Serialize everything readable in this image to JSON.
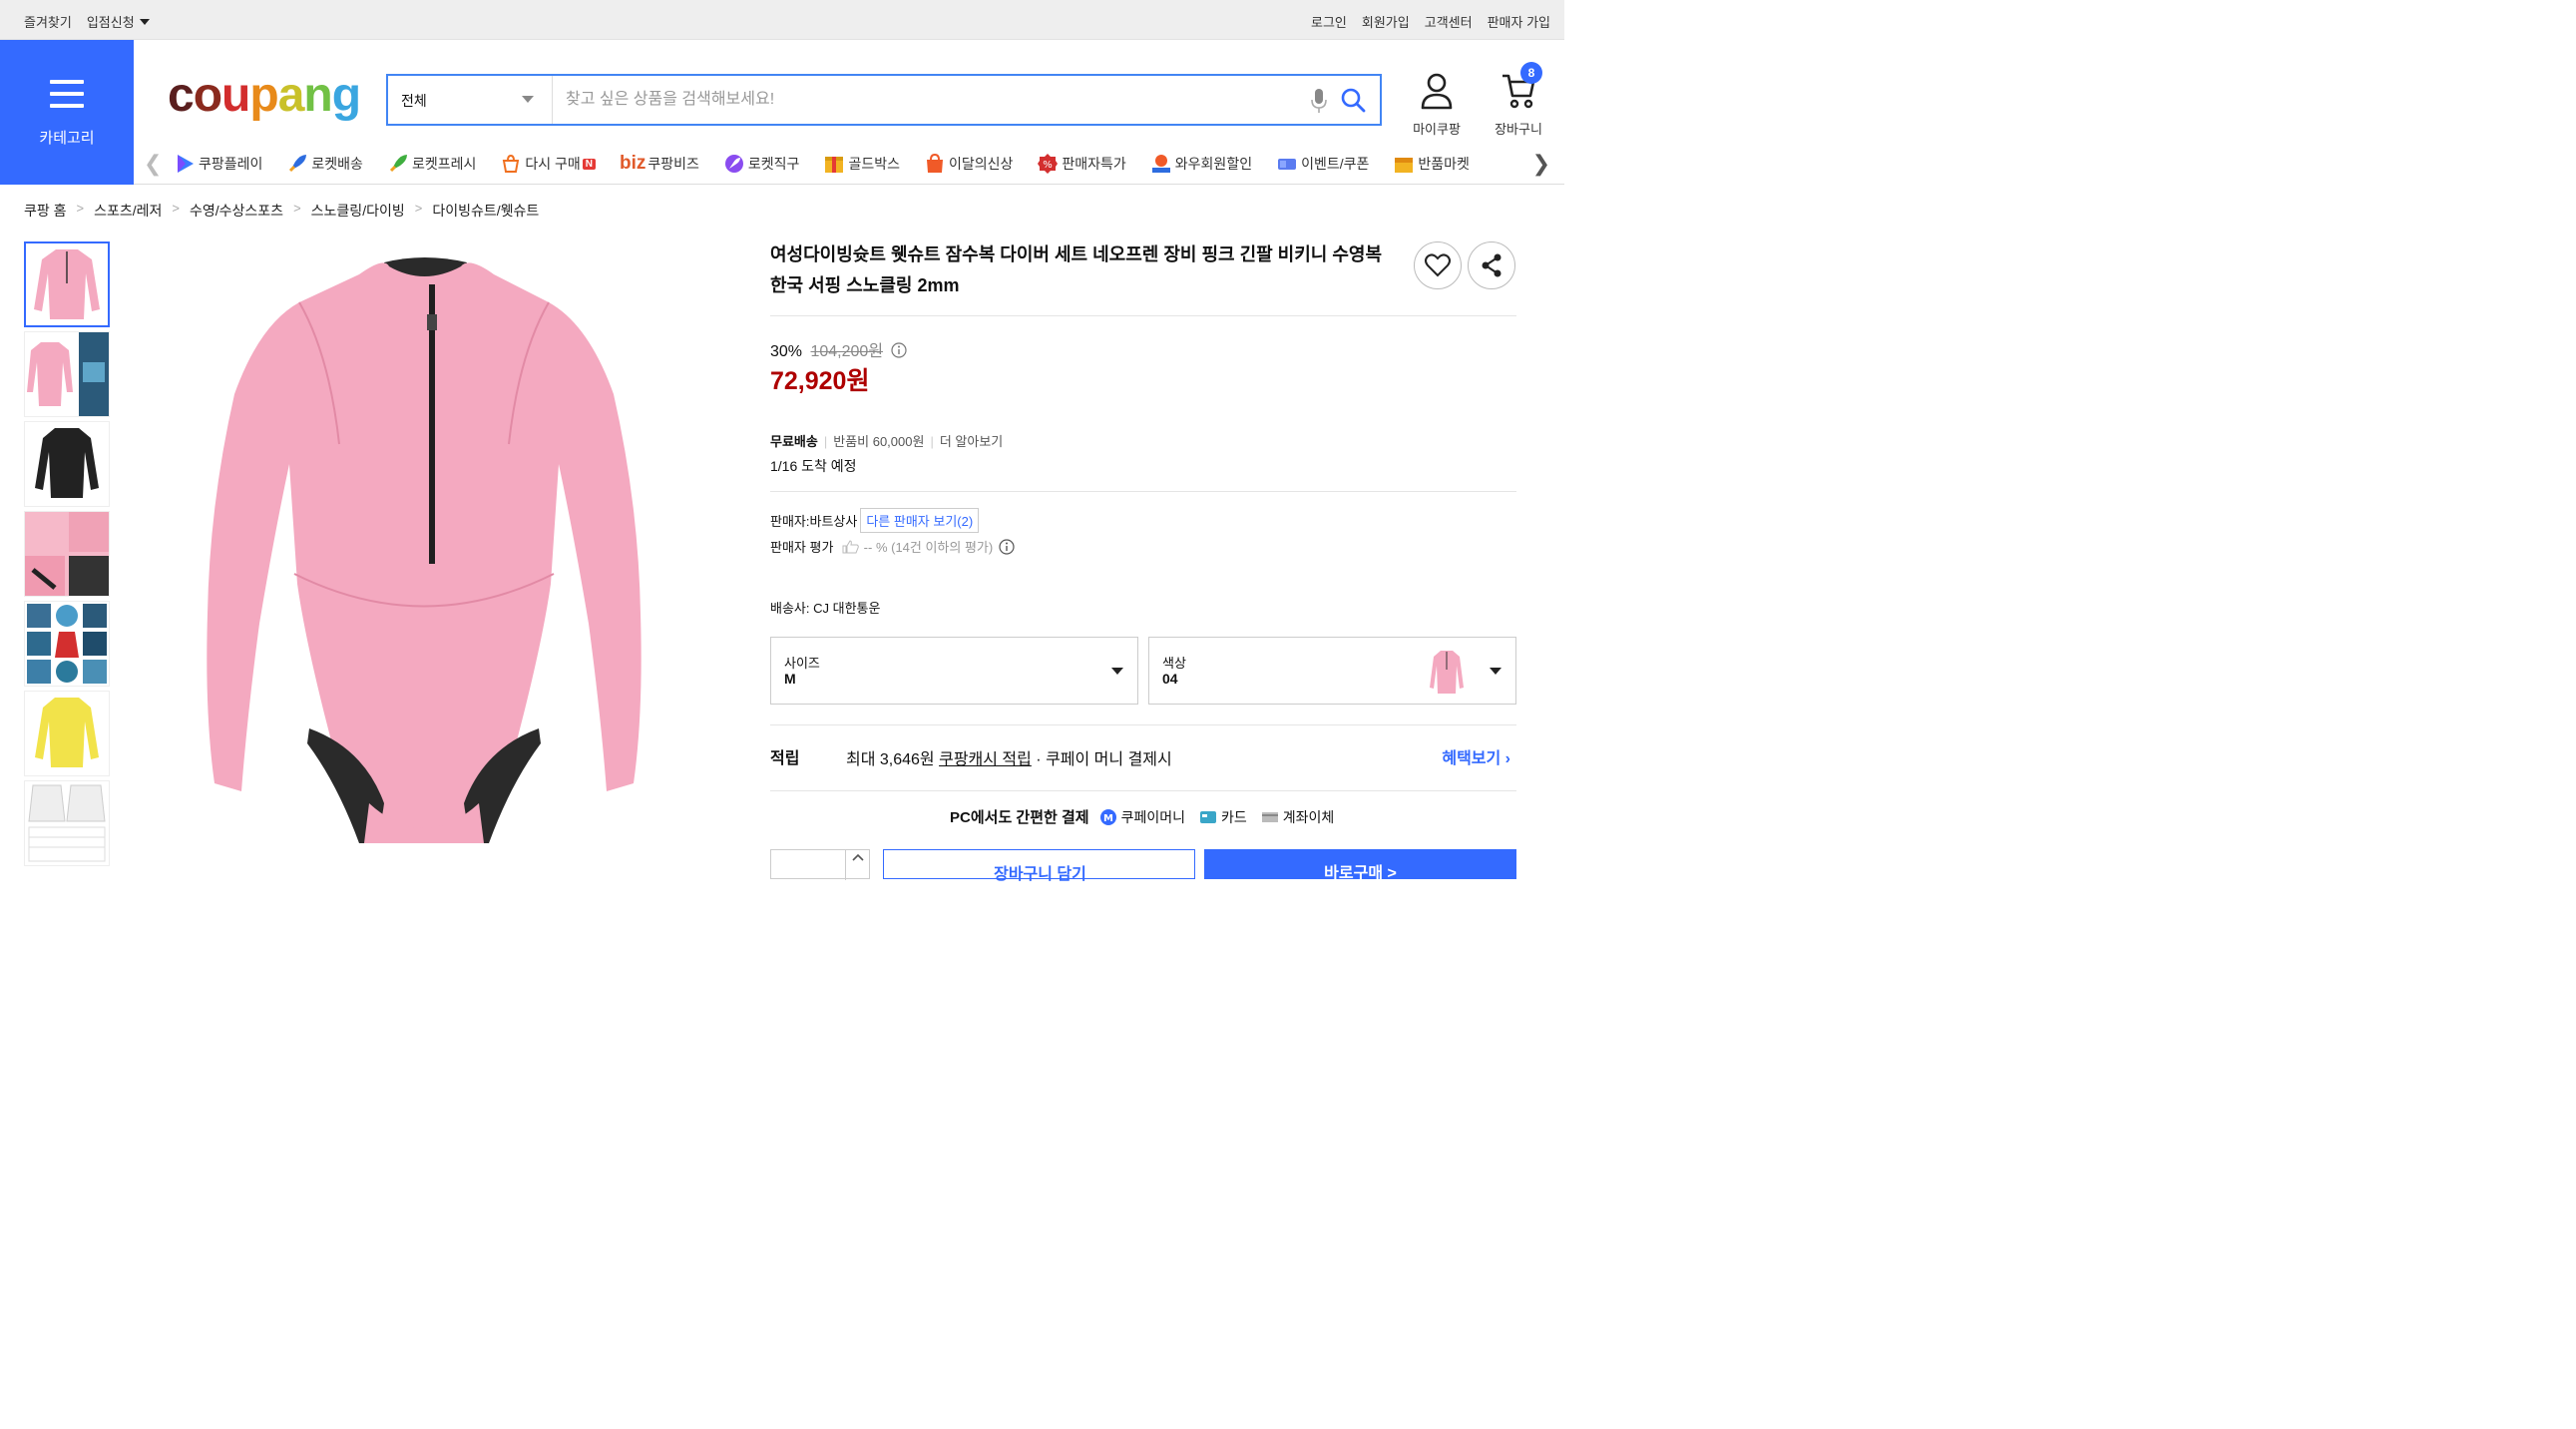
{
  "topbar": {
    "left": [
      "즐겨찾기",
      "입점신청"
    ],
    "right": [
      "로그인",
      "회원가입",
      "고객센터",
      "판매자 가입"
    ]
  },
  "header": {
    "category_label": "카테고리",
    "logo": "coupang",
    "search_category": "전체",
    "search_placeholder": "찾고 싶은 상품을 검색해보세요!",
    "mypage_label": "마이쿠팡",
    "cart_label": "장바구니",
    "cart_count": "8"
  },
  "catnav": [
    {
      "label": "쿠팡플레이",
      "icon": "play-icon"
    },
    {
      "label": "로켓배송",
      "icon": "rocket-icon"
    },
    {
      "label": "로켓프레시",
      "icon": "rocket-fresh-icon"
    },
    {
      "label": "다시 구매",
      "icon": "rebuy-icon",
      "new": "N"
    },
    {
      "label": "쿠팡비즈",
      "icon": "biz-icon",
      "prefix": "biz"
    },
    {
      "label": "로켓직구",
      "icon": "rocket-global-icon"
    },
    {
      "label": "골드박스",
      "icon": "goldbox-icon"
    },
    {
      "label": "이달의신상",
      "icon": "new-arrival-icon"
    },
    {
      "label": "판매자특가",
      "icon": "seller-deal-icon"
    },
    {
      "label": "와우회원할인",
      "icon": "wow-icon"
    },
    {
      "label": "이벤트/쿠폰",
      "icon": "coupon-icon"
    },
    {
      "label": "반품마켓",
      "icon": "return-market-icon"
    }
  ],
  "breadcrumb": [
    "쿠팡 홈",
    "스포츠/레저",
    "수영/수상스포츠",
    "스노클링/다이빙",
    "다이빙슈트/웻슈트"
  ],
  "product": {
    "title_line1": "여성다이빙슛트 웻슈트 잠수복 다이버 세트 네오프렌 장비 핑크 긴팔 비키니 수영복",
    "title_line2": "한국 서핑 스노클링 2mm",
    "discount": "30%",
    "original_price": "104,200원",
    "price": "72,920원",
    "shipping_free": "무료배송",
    "return_fee": "반품비 60,000원",
    "more_info": "더 알아보기",
    "arrival": "1/16 도착 예정",
    "seller": "판매자:바트상사",
    "other_sellers": "다른 판매자 보기(2)",
    "seller_rating_label": "판매자 평가",
    "seller_rating_value": "-- % (14건 이하의 평가)",
    "courier": "배송사:  CJ 대한통운",
    "option_size_label": "사이즈",
    "option_size_value": "M",
    "option_color_label": "색상",
    "option_color_value": "04",
    "reward_label": "적립",
    "reward_text_pre": "최대 3,646원 ",
    "reward_text_link": "쿠팡캐시 적립",
    "reward_text_post": " · 쿠페이 머니 결제시",
    "benefit_link": "혜택보기 ›",
    "pay_title": "PC에서도 간편한 결제",
    "pay_methods": [
      "쿠페이머니",
      "카드",
      "계좌이체"
    ],
    "cart_button": "장바구니 담기",
    "buy_button": "바로구매 >"
  },
  "colors": {
    "brand_blue": "#346aff",
    "price_red": "#ae0000",
    "suit_pink": "#f4a9c0"
  }
}
